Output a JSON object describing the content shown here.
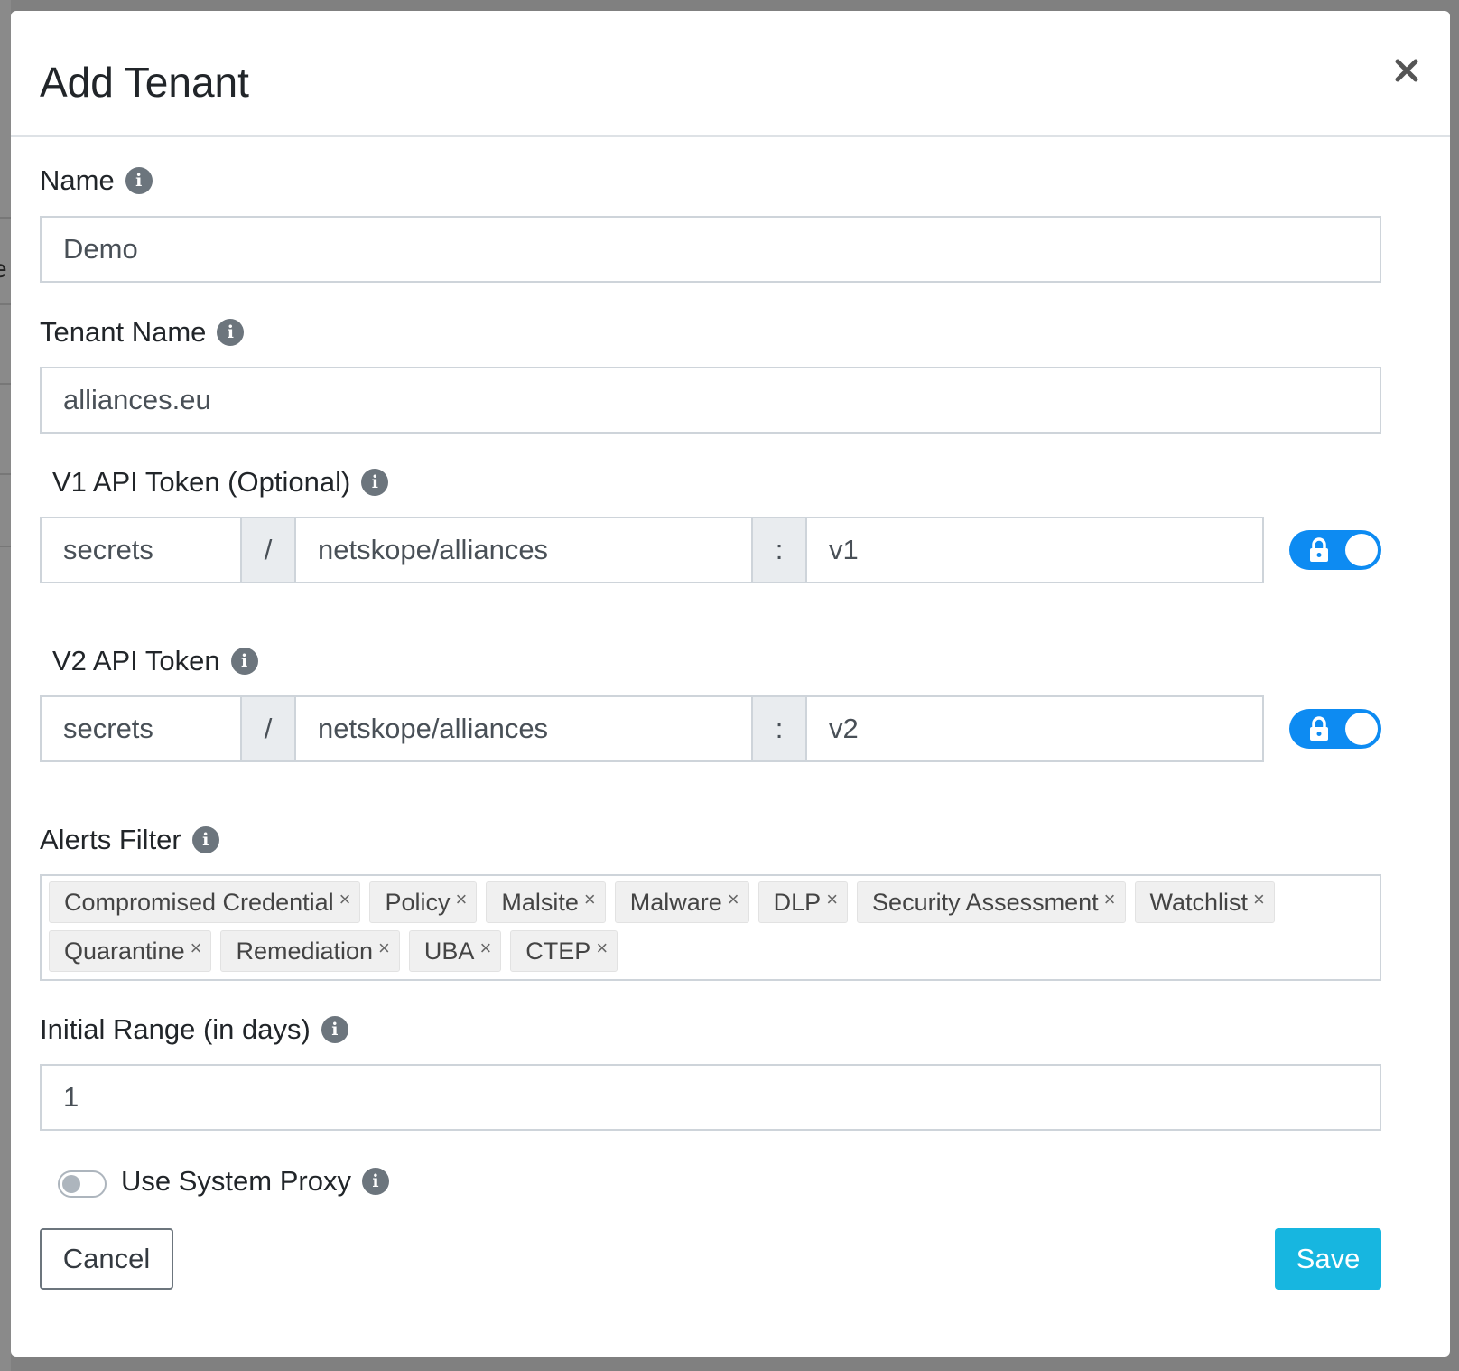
{
  "modal": {
    "title": "Add Tenant",
    "close_icon": "close-icon"
  },
  "backdrop": {
    "peek_char": "e"
  },
  "form": {
    "name": {
      "label": "Name",
      "value": "Demo"
    },
    "tenant_name": {
      "label": "Tenant Name",
      "value": "alliances.eu"
    },
    "v1_token": {
      "label": "V1 API Token (Optional)",
      "store": "secrets",
      "sep1": "/",
      "path": "netskope/alliances",
      "sep2": ":",
      "key": "v1",
      "locked": true
    },
    "v2_token": {
      "label": "V2 API Token",
      "store": "secrets",
      "sep1": "/",
      "path": "netskope/alliances",
      "sep2": ":",
      "key": "v2",
      "locked": true
    },
    "alerts_filter": {
      "label": "Alerts Filter",
      "remove_glyph": "×",
      "chips": [
        "Compromised Credential",
        "Policy",
        "Malsite",
        "Malware",
        "DLP",
        "Security Assessment",
        "Watchlist",
        "Quarantine",
        "Remediation",
        "UBA",
        "CTEP"
      ]
    },
    "initial_range": {
      "label": "Initial Range (in days)",
      "value": "1"
    },
    "system_proxy": {
      "label": "Use System Proxy",
      "enabled": false
    }
  },
  "footer": {
    "cancel_label": "Cancel",
    "save_label": "Save"
  },
  "colors": {
    "accent_toggle": "#0d8bf2",
    "save_button": "#17b6e0",
    "info_icon": "#6c757d"
  }
}
